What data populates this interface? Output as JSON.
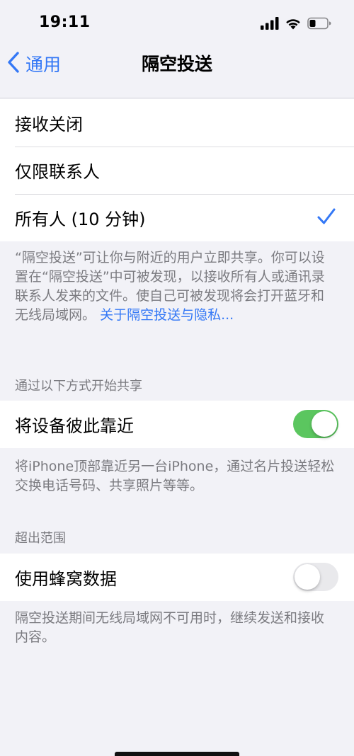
{
  "status_bar": {
    "time": "19:11",
    "icons": [
      "signal-icon",
      "wifi-icon",
      "battery-icon"
    ]
  },
  "nav": {
    "back_label": "通用",
    "title": "隔空投送"
  },
  "receive_options": {
    "items": [
      {
        "label": "接收关闭",
        "selected": false
      },
      {
        "label": "仅限联系人",
        "selected": false
      },
      {
        "label": "所有人 (10 分钟)",
        "selected": true
      }
    ],
    "footer": "“隔空投送”可让你与附近的用户立即共享。你可以设置在“隔空投送”中可被发现，以接收所有人或通讯录联系人发来的文件。使自己可被发现将会打开蓝牙和无线局域网。",
    "footer_link": "关于隔空投送与隐私..."
  },
  "start_sharing": {
    "header": "通过以下方式开始共享",
    "row_label": "将设备彼此靠近",
    "toggle_on": true,
    "footer": "将iPhone顶部靠近另一台iPhone，通过名片投送轻松交换电话号码、共享照片等等。"
  },
  "out_of_range": {
    "header": "超出范围",
    "row_label": "使用蜂窝数据",
    "toggle_on": false,
    "footer": "隔空投送期间无线局域网不可用时，继续发送和接收内容。"
  },
  "colors": {
    "accent": "#3478f6",
    "toggle_on": "#5bc65f",
    "background": "#f2f2f7",
    "secondary_text": "#7b7b80"
  }
}
